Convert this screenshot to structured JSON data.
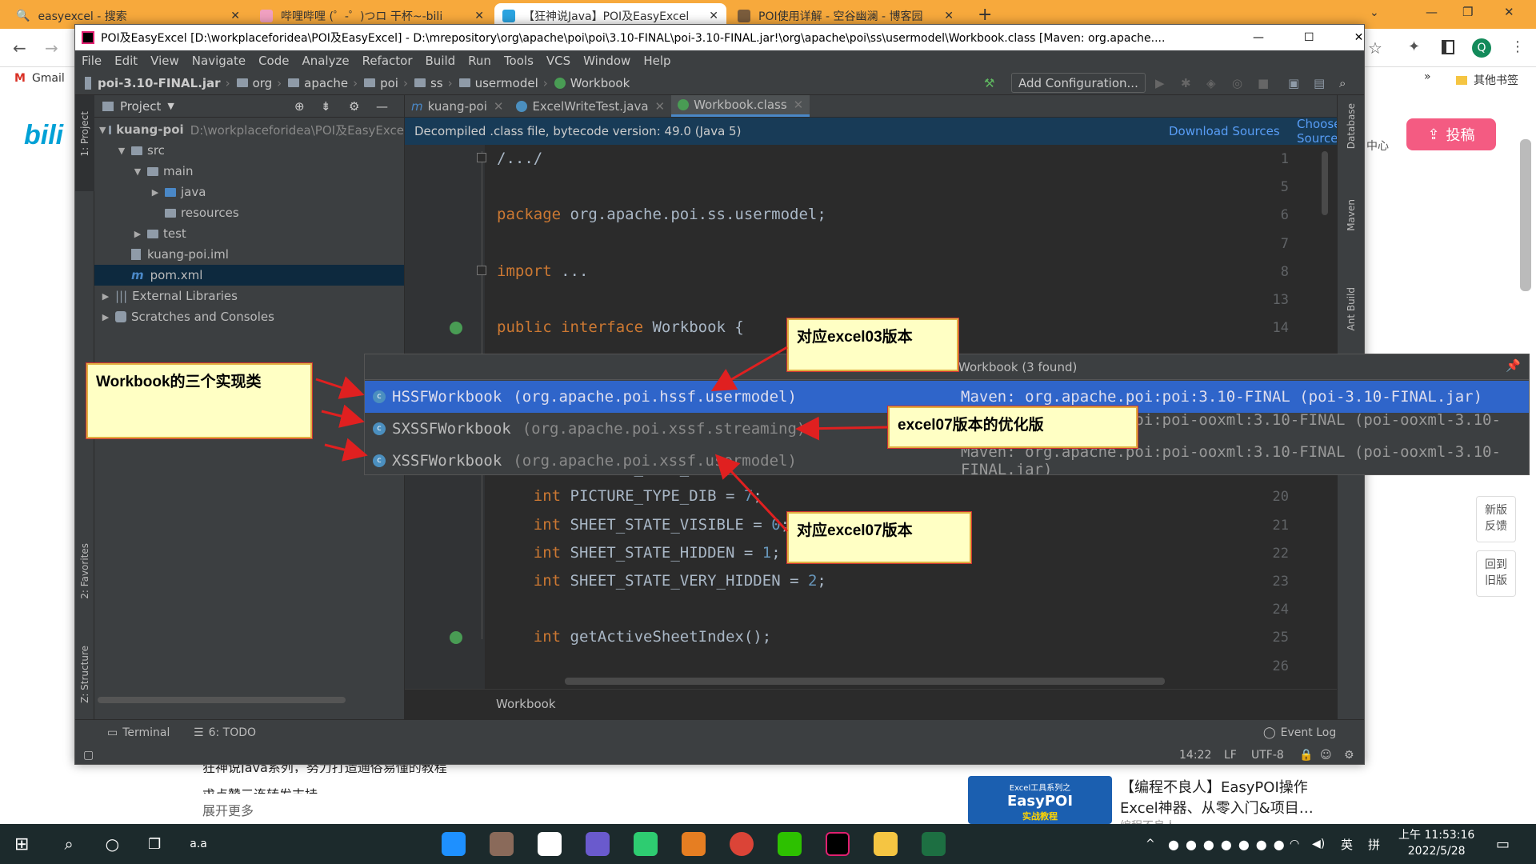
{
  "browser": {
    "tabs": [
      {
        "label": "easyexcel - 搜索",
        "icon": "search-icon"
      },
      {
        "label": "哔哩哔哩 (゜-゜)つロ 干杯~-bili",
        "icon": "bilibili-icon"
      },
      {
        "label": "【狂神说Java】POI及EasyExcel",
        "icon": "bilibili-icon"
      },
      {
        "label": "POI使用详解 - 空谷幽澜 - 博客园",
        "icon": "cnblogs-icon"
      }
    ],
    "new_tab": "+",
    "bookmarks": {
      "gmail": "Gmail",
      "more": "»",
      "other": "其他书签"
    },
    "profile_initial": "Q"
  },
  "page": {
    "upload_button": "投稿",
    "center_text": "中心",
    "feedback": [
      "新版",
      "反馈"
    ],
    "back_old": [
      "回到",
      "旧版"
    ],
    "desc_line1": "狂神说Java系列，努力打造通俗易懂的教程",
    "desc_line2": "求点赞三连转发支持",
    "expand": "展开更多",
    "rec_title_line1": "【编程不良人】EasyPOI操作",
    "rec_title_line2": "Excel神器、从零入门&项目…",
    "rec_author": "编程不良人",
    "rec_thumb_small": "Excel工具系列之",
    "rec_thumb_big": "EasyPOI",
    "rec_thumb_sub": "实战教程"
  },
  "ide": {
    "title": "POI及EasyExcel [D:\\workplaceforidea\\POI及EasyExcel] - D:\\mrepository\\org\\apache\\poi\\poi\\3.10-FINAL\\poi-3.10-FINAL.jar!\\org\\apache\\poi\\ss\\usermodel\\Workbook.class [Maven: org.apache....",
    "menu": [
      "File",
      "Edit",
      "View",
      "Navigate",
      "Code",
      "Analyze",
      "Refactor",
      "Build",
      "Run",
      "Tools",
      "VCS",
      "Window",
      "Help"
    ],
    "breadcrumb": [
      "poi-3.10-FINAL.jar",
      "org",
      "apache",
      "poi",
      "ss",
      "usermodel",
      "Workbook"
    ],
    "add_config": "Add Configuration...",
    "project_header": "Project",
    "tree": [
      {
        "label": "kuang-poi",
        "extra": "D:\\workplaceforidea\\POI及EasyExce",
        "depth": 0,
        "arrow": "▼"
      },
      {
        "label": "src",
        "extra": "",
        "depth": 1,
        "arrow": "▼"
      },
      {
        "label": "main",
        "extra": "",
        "depth": 2,
        "arrow": "▼"
      },
      {
        "label": "java",
        "extra": "",
        "depth": 3,
        "arrow": "▶"
      },
      {
        "label": "resources",
        "extra": "",
        "depth": 3,
        "arrow": ""
      },
      {
        "label": "test",
        "extra": "",
        "depth": 2,
        "arrow": "▶"
      },
      {
        "label": "kuang-poi.iml",
        "extra": "",
        "depth": 1,
        "arrow": ""
      },
      {
        "label": "pom.xml",
        "extra": "",
        "depth": 1,
        "arrow": ""
      },
      {
        "label": "External Libraries",
        "extra": "",
        "depth": 0,
        "arrow": "▶"
      },
      {
        "label": "Scratches and Consoles",
        "extra": "",
        "depth": 0,
        "arrow": "▶"
      }
    ],
    "editor_tabs": [
      "kuang-poi",
      "ExcelWriteTest.java",
      "Workbook.class"
    ],
    "banner_text": "Decompiled .class file, bytecode version: 49.0 (Java 5)",
    "download_sources": "Download Sources",
    "choose_sources": "Choose Sources...",
    "code_lines": [
      {
        "n": "1",
        "text": "/.../"
      },
      {
        "n": "5",
        "text": ""
      },
      {
        "n": "6",
        "text": "package org.apache.poi.ss.usermodel;"
      },
      {
        "n": "7",
        "text": ""
      },
      {
        "n": "8",
        "text": "import ..."
      },
      {
        "n": "13",
        "text": ""
      },
      {
        "n": "14",
        "text": "public interface Workbook {"
      },
      {
        "n": "19",
        "text": "    int PICTURE_TYPE_PNG = 6;"
      },
      {
        "n": "20",
        "text": "    int PICTURE_TYPE_DIB = 7;"
      },
      {
        "n": "21",
        "text": "    int SHEET_STATE_VISIBLE = 0;"
      },
      {
        "n": "22",
        "text": "    int SHEET_STATE_HIDDEN = 1;"
      },
      {
        "n": "23",
        "text": "    int SHEET_STATE_VERY_HIDDEN = 2;"
      },
      {
        "n": "24",
        "text": ""
      },
      {
        "n": "25",
        "text": "    int getActiveSheetIndex();"
      },
      {
        "n": "26",
        "text": ""
      }
    ],
    "popup_title": "Workbook (3 found)",
    "implementations": [
      {
        "cls": "HSSFWorkbook",
        "pkg": "(org.apache.poi.hssf.usermodel)",
        "maven": "Maven: org.apache.poi:poi:3.10-FINAL (poi-3.10-FINAL.jar)"
      },
      {
        "cls": "SXSSFWorkbook",
        "pkg": "(org.apache.poi.xssf.streaming)",
        "maven": "Maven: org.apache.poi:poi-ooxml:3.10-FINAL (poi-ooxml-3.10-FINAL.jar)"
      },
      {
        "cls": "XSSFWorkbook",
        "pkg": "(org.apache.poi.xssf.usermodel)",
        "maven": "Maven: org.apache.poi:poi-ooxml:3.10-FINAL (poi-ooxml-3.10-FINAL.jar)"
      }
    ],
    "editor_footer": "Workbook",
    "side_left": [
      "1: Project",
      "2: Favorites",
      "Z: Structure"
    ],
    "side_right": [
      "Database",
      "Maven",
      "Ant Build"
    ],
    "terminal": "Terminal",
    "todo": "6: TODO",
    "event_log": "Event Log",
    "status": {
      "pos": "14:22",
      "sep": "LF",
      "enc": "UTF-8"
    }
  },
  "notes": {
    "three_impl": "Workbook的三个实现类",
    "excel03": "对应excel03版本",
    "excel07_opt": "excel07版本的优化版",
    "excel07": "对应excel07版本"
  },
  "taskbar": {
    "app_text": "a.a",
    "time": "上午 11:53:16",
    "date": "2022/5/28",
    "ime1": "英",
    "ime2": "拼"
  },
  "colors": {
    "accent": "#f7a93c",
    "ide_bg": "#2b2b2b",
    "selection": "#2f65ca",
    "note_bg": "#ffffc4",
    "arrow": "#e02020"
  }
}
